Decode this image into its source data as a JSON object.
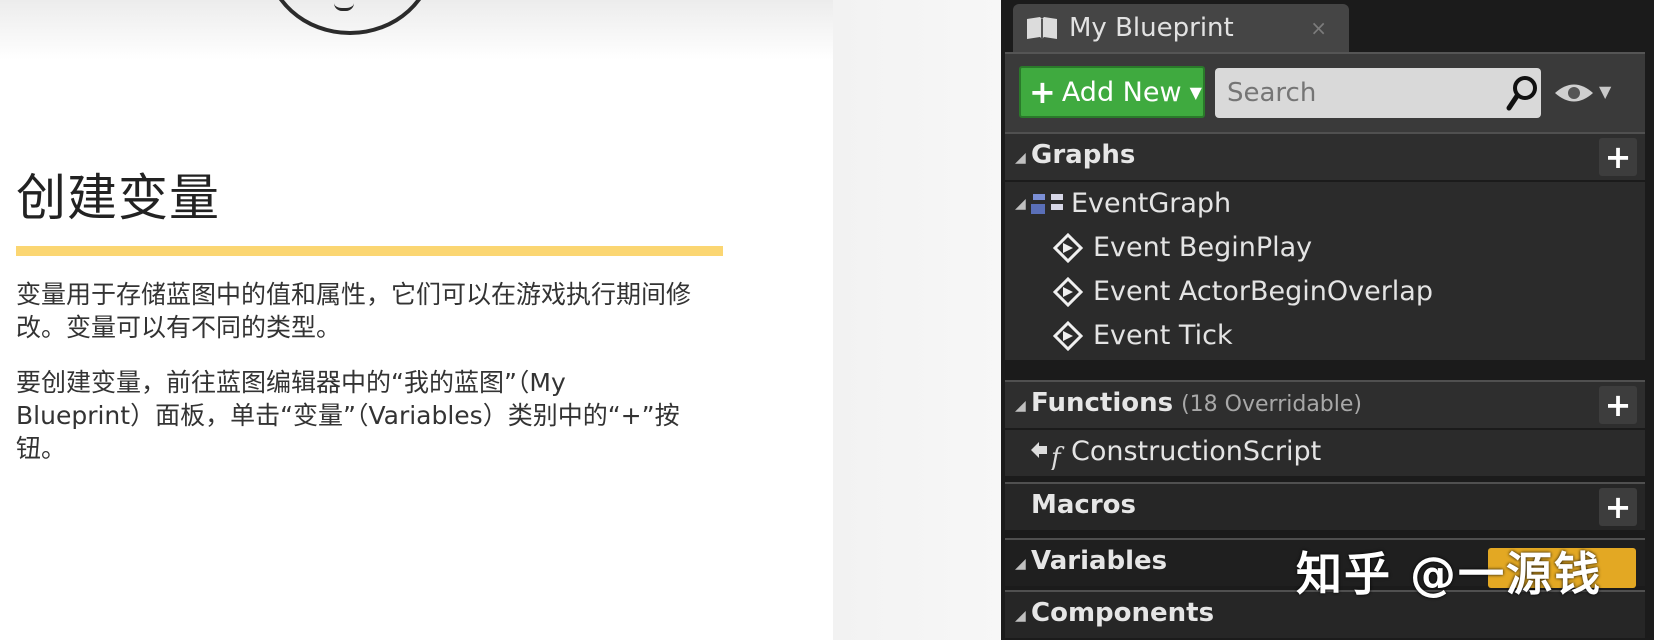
{
  "slide": {
    "title": "创建变量",
    "paragraph1": "变量用于存储蓝图中的值和属性，它们可以在游戏执行期间修改。变量可以有不同的类型。",
    "paragraph2": "要创建变量，前往蓝图编辑器中的“我的蓝图”（My Blueprint）面板，单击“变量”（Variables）类别中的“+”按钮。",
    "accent_color": "#fbd672"
  },
  "panel": {
    "tab_title": "My Blueprint",
    "tab_close": "×",
    "add_new_label": "Add New",
    "search_placeholder": "Search",
    "sections": {
      "graphs": "Graphs",
      "functions": "Functions",
      "functions_sub": "(18 Overridable)",
      "macros": "Macros",
      "variables": "Variables",
      "components": "Components"
    },
    "event_graph": "EventGraph",
    "events": [
      "Event BeginPlay",
      "Event ActorBeginOverlap",
      "Event Tick"
    ],
    "construction_script": "ConstructionScript",
    "add_button_color": "#3faa3f",
    "variable_add_color": "#e3a823"
  },
  "watermark": "知乎 @一源钱"
}
